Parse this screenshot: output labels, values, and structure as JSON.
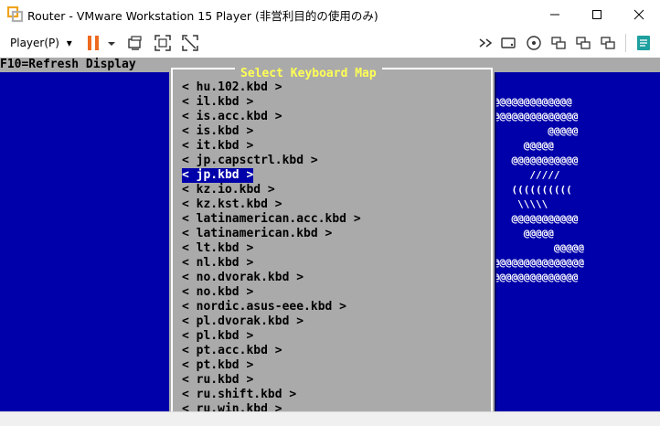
{
  "window": {
    "title": "Router - VMware Workstation 15 Player (非営利目的の使用のみ)",
    "minimize_glyph": "—",
    "maximize_glyph": "☐",
    "close_glyph": "✕"
  },
  "toolbar": {
    "player_menu_label": "Player(P)",
    "dropdown_glyph": "▾",
    "colors": {
      "pause_accent": "#ee6a1f",
      "notes_accent": "#1ea0a0"
    }
  },
  "console": {
    "f10_hint": "F10=Refresh Display",
    "dialog_title": "Select Keyboard Map",
    "items": [
      "< hu.102.kbd >",
      "< il.kbd >",
      "< is.acc.kbd >",
      "< is.kbd >",
      "< it.kbd >",
      "< jp.capsctrl.kbd >",
      "< jp.kbd >",
      "< kz.io.kbd >",
      "< kz.kst.kbd >",
      "< latinamerican.acc.kbd >",
      "< latinamerican.kbd >",
      "< lt.kbd >",
      "< nl.kbd >",
      "< no.dvorak.kbd >",
      "< no.kbd >",
      "< nordic.asus-eee.kbd >",
      "< pl.dvorak.kbd >",
      "< pl.kbd >",
      "< pt.acc.kbd >",
      "< pt.kbd >",
      "< ru.kbd >",
      "< ru.shift.kbd >",
      "< ru.win.kbd >"
    ],
    "selected_index": 6,
    "ascii_art": [
      "",
      "",
      "@@@@@@@@@@@@@@",
      "@@@@@@@@@@@@@@@",
      "          @@@@@",
      "      @@@@@",
      "    @@@@@@@@@@@",
      "       /////",
      "    ((((((((((",
      "     \\\\\\\\\\",
      "    @@@@@@@@@@@",
      "#     @@@@@",
      "#          @@@@@",
      "#@@@@@@@@@@@@@@@",
      "#@@@@@@@@@@@@@@",
      "#"
    ],
    "colors": {
      "bg": "#0000aa",
      "panel": "#aaaaaa",
      "title": "#ffff55",
      "selected_bg": "#0000aa"
    }
  }
}
